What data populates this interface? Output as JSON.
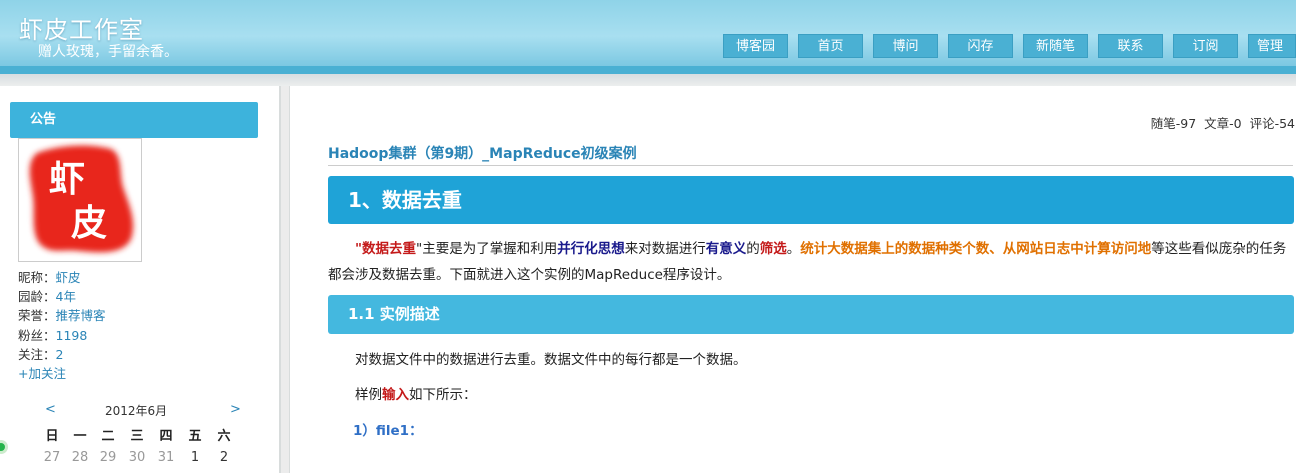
{
  "header": {
    "title": "虾皮工作室",
    "subtitle": "赠人玫瑰，手留余香。",
    "nav": [
      "博客园",
      "首页",
      "博问",
      "闪存",
      "新随笔",
      "联系",
      "订阅",
      "管理"
    ]
  },
  "sidebar": {
    "notice_title": "公告",
    "avatar_text": "虾皮",
    "info": [
      {
        "label": "昵称：",
        "value": "虾皮"
      },
      {
        "label": "园龄：",
        "value": "4年"
      },
      {
        "label": "荣誉：",
        "value": "推荐博客"
      },
      {
        "label": "粉丝：",
        "value": "1198"
      },
      {
        "label": "关注：",
        "value": "2"
      }
    ],
    "follow": "+加关注",
    "calendar": {
      "prev": "<",
      "month": "2012年6月",
      "next": ">",
      "weekdays": [
        "日",
        "一",
        "二",
        "三",
        "四",
        "五",
        "六"
      ],
      "days": [
        "27",
        "28",
        "29",
        "30",
        "31",
        "1",
        "2"
      ]
    }
  },
  "main": {
    "stats": "随笔-97  文章-0  评论-54",
    "post_title": "Hadoop集群（第9期）_MapReduce初级案例",
    "h1": "1、数据去重",
    "para1": {
      "q1": "\"",
      "t1": "数据去重",
      "t2": "\"主要是为了掌握和利用",
      "t3": "并行化思想",
      "t4": "来对数据进行",
      "t5": "有意义",
      "t6": "的",
      "t7": "筛选",
      "t8": "。",
      "t9": "统计大数据集上的数据种类个数",
      "t10": "、",
      "t11": "从网站日志中计算访问地",
      "t12": "等这些看似庞杂的任务都会涉及数据去重。下面就进入这个实例的MapReduce程序设计。"
    },
    "h2": "1.1 实例描述",
    "para2": "对数据文件中的数据进行去重。数据文件中的每行都是一个数据。",
    "para3": {
      "a": "样例",
      "b": "输入",
      "c": "如下所示："
    },
    "file1": "1）file1："
  },
  "colors": {
    "accent": "#1fa3d7",
    "subheading": "#44b8df",
    "link": "#2a84b6",
    "highlight_red": "#c41a1a",
    "highlight_orange": "#e07000"
  }
}
